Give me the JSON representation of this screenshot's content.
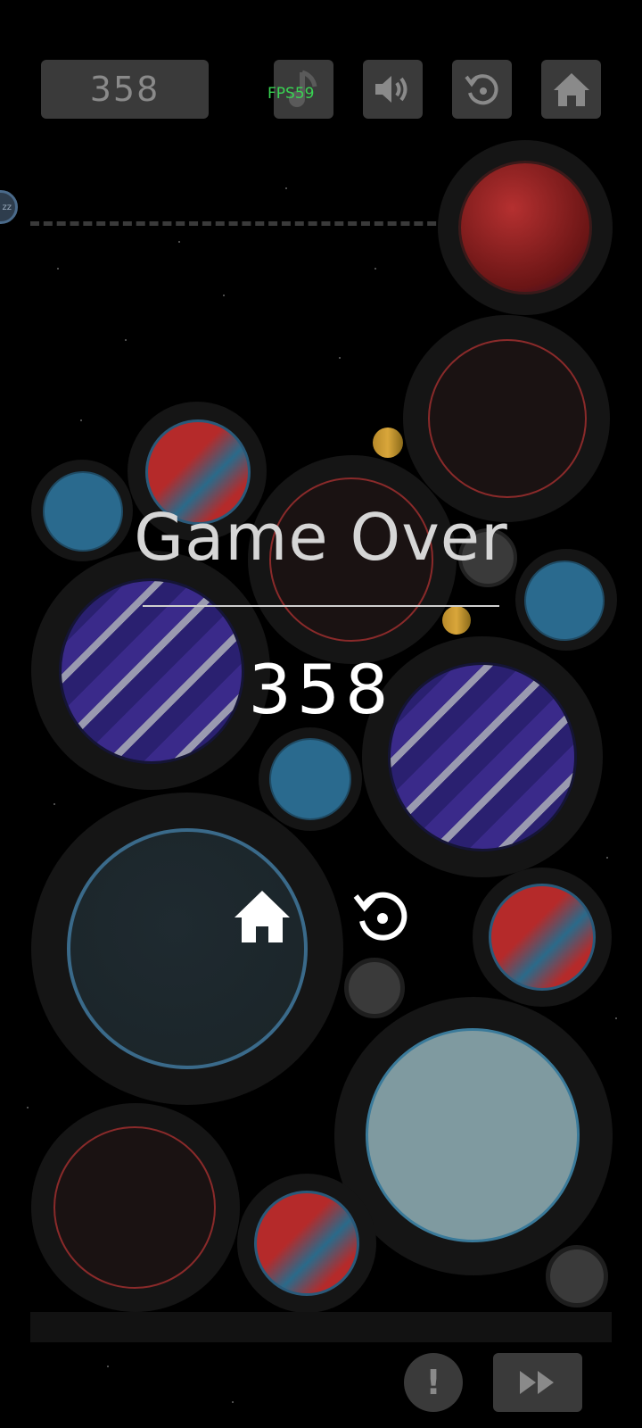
{
  "hud": {
    "score": "358",
    "fps": "FPS59",
    "buttons": [
      {
        "name": "music-button",
        "icon": "music-note-icon"
      },
      {
        "name": "sound-button",
        "icon": "speaker-icon"
      },
      {
        "name": "restart-button",
        "icon": "restart-icon"
      },
      {
        "name": "home-button",
        "icon": "home-icon"
      }
    ],
    "next_ball_label": "zz"
  },
  "game_over": {
    "title": "Game Over",
    "score": "358",
    "actions": [
      {
        "name": "home-button",
        "icon": "home-icon"
      },
      {
        "name": "restart-button",
        "icon": "restart-icon"
      }
    ]
  },
  "footer": {
    "warning_label": "!",
    "fast_forward_icon": "fast-forward-icon"
  },
  "colors": {
    "background": "#000000",
    "button_bg": "#3a3a3a",
    "icon_gray": "#8a8a8a",
    "fps_green": "#39d353"
  }
}
